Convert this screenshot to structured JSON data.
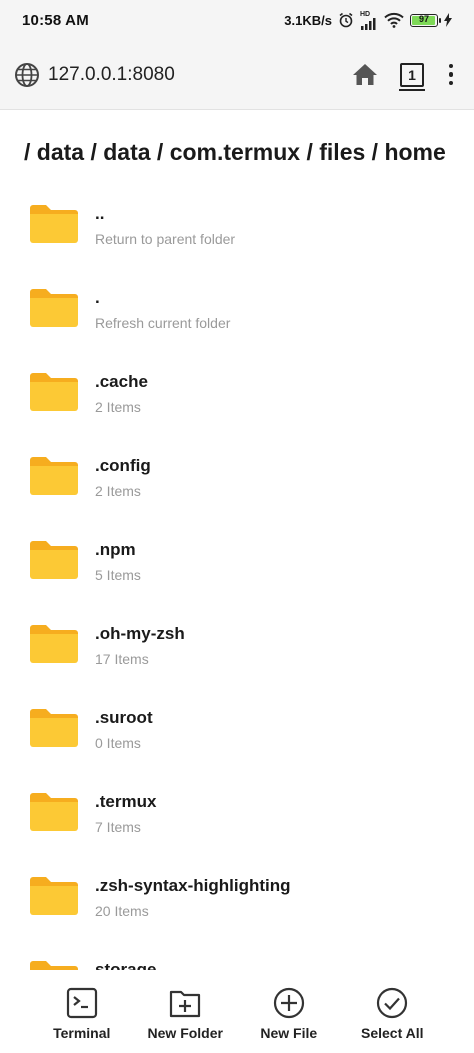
{
  "status_bar": {
    "time": "10:58 AM",
    "speed": "3.1KB/s",
    "network": "HD",
    "battery": "97",
    "battery_level": 0.97
  },
  "address_bar": {
    "url": "127.0.0.1:8080",
    "tab_count": "1"
  },
  "breadcrumb": "/ data / data / com.termux / files / home",
  "files": [
    {
      "name": "..",
      "sub": "Return to parent folder"
    },
    {
      "name": ".",
      "sub": "Refresh current folder"
    },
    {
      "name": ".cache",
      "sub": "2 Items"
    },
    {
      "name": ".config",
      "sub": "2 Items"
    },
    {
      "name": ".npm",
      "sub": "5 Items"
    },
    {
      "name": ".oh-my-zsh",
      "sub": "17 Items"
    },
    {
      "name": ".suroot",
      "sub": "0 Items"
    },
    {
      "name": ".termux",
      "sub": "7 Items"
    },
    {
      "name": ".zsh-syntax-highlighting",
      "sub": "20 Items"
    },
    {
      "name": "storage",
      "sub": ""
    }
  ],
  "toolbar": {
    "terminal": "Terminal",
    "new_folder": "New Folder",
    "new_file": "New File",
    "select_all": "Select All"
  },
  "colors": {
    "folder_front": "#fcc935",
    "folder_back": "#f6ad1f",
    "battery_fill": "#7ed957"
  }
}
